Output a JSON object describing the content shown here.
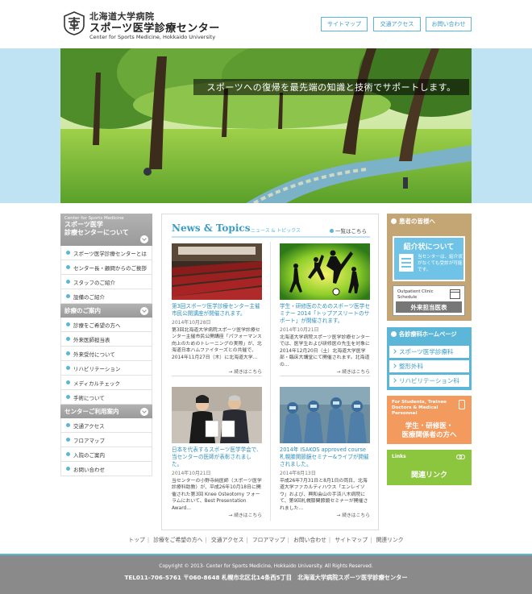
{
  "header": {
    "university_line": "北海道大学病院",
    "center_name": "スポーツ医学診療センター",
    "english_name": "Center for Sports Medicine, Hokkaido University",
    "buttons": {
      "sitemap": "サイトマップ",
      "access": "交通アクセス",
      "contact": "お問い合わせ"
    }
  },
  "hero": {
    "caption": "スポーツへの復帰を最先端の知識と技術でサポートします。"
  },
  "sidebar": {
    "section1": {
      "title_en": "Center for Sports Medicine",
      "title_jp1": "スポーツ医学",
      "title_jp2": "診療センターについて",
      "items": [
        "スポーツ医学診療センターとは",
        "センター長・顧問からのご挨拶",
        "スタッフのご紹介",
        "設備のご紹介"
      ]
    },
    "section2": {
      "title": "診療のご案内",
      "items": [
        "診療をご希望の方へ",
        "外来医師担当表",
        "外来受付について",
        "リハビリテーション",
        "メディカルチェック",
        "手術について"
      ]
    },
    "section3": {
      "title": "センターご利用案内",
      "items": [
        "交通アクセス",
        "フロアマップ",
        "入院のご案内",
        "お問い合わせ"
      ]
    }
  },
  "news": {
    "title": "News & Topics",
    "subtitle": "ニュース & トピックス",
    "view_all": "一覧はこちら",
    "more_label": "→ 続きはこちら",
    "items": [
      {
        "title": "第3回スポーツ医学診療センター主催市民公開講座が開催されます。",
        "date": "2014年10月28日",
        "body": "第3回北海道大学病院スポーツ医学診療センター主催市民公開講座「パフォーマンス向上のためのトレーニングの実際」が、北海道日本ハムファイターズとの共催で、2014年11月27日（木）に北海道大学..."
      },
      {
        "title": "学生・研修医のためのスポーツ医学セミナー 2014「トップアスリートのサポート」が開催されます。",
        "date": "2014年10月21日",
        "body": "北海道大学病院スポーツ医学診療センターでは、医学生および研修医の先生を対象に2014年12月20日（土）北海道大学医学部・臨床大講堂にて開催されます。北海道の..."
      },
      {
        "title": "日本を代表するスポーツ医学学会で、当センターの医師が表彰されました。",
        "date": "2014年10月21日",
        "body": "当センターの小野寺純医師（スポーツ医学診療科助教）が、平成26年10月18日に開催された第3回 Knee Osteotomy フォーラムにおいて、Best Presentation Award..."
      },
      {
        "title": "2014年 ISAKOS approved course 札幌膝関節鏡セミナー&ライブが開催されました。",
        "date": "2014年8月13日",
        "body": "平成26年7月31日と8月1日の両日、北海道大学ファカルティハウス「エンレイソウ」および、興和会山の手済八木病院にて、第9回札幌膝関節鏡セミナーが開催されました..."
      }
    ]
  },
  "right": {
    "patients_title": "患者の皆様へ",
    "referral_title": "紹介状について",
    "referral_desc": "当センターは、紹介状がなくても受診が可能です。",
    "outpatient_en": "Outpatient Clinic Schedule",
    "outpatient_jp": "外来担当医表",
    "dept_title": "各診療科ホームページ",
    "depts": [
      "スポーツ医学診療科",
      "整形外科",
      "リハビリテーション科"
    ],
    "students_en": "For Students, Trainee Doctors & Medical Personnel",
    "students_jp1": "学生・研修医・",
    "students_jp2": "医療関係者の方へ",
    "links_en": "Links",
    "links_jp": "関連リンク"
  },
  "footer": {
    "nav": [
      "トップ",
      "診療をご希望の方へ",
      "交通アクセス",
      "フロアマップ",
      "お問い合わせ",
      "サイトマップ",
      "関連リンク"
    ],
    "copyright": "Copyright © 2013- Center for Sports Medicine, Hokkaido University. All Rights Reserved.",
    "address": "TEL011-706-5761 〒060-8648 札幌市北区北14条西5丁目　北海道大学病院スポーツ医学診療センター"
  },
  "colors": {
    "accent": "#5bb6d8",
    "sidebar_gray": "#9a9a9a",
    "patient_tan": "#c4a574",
    "student_orange": "#f39a5f",
    "links_green": "#8cc63f",
    "footer_gray": "#8a8a8a"
  }
}
